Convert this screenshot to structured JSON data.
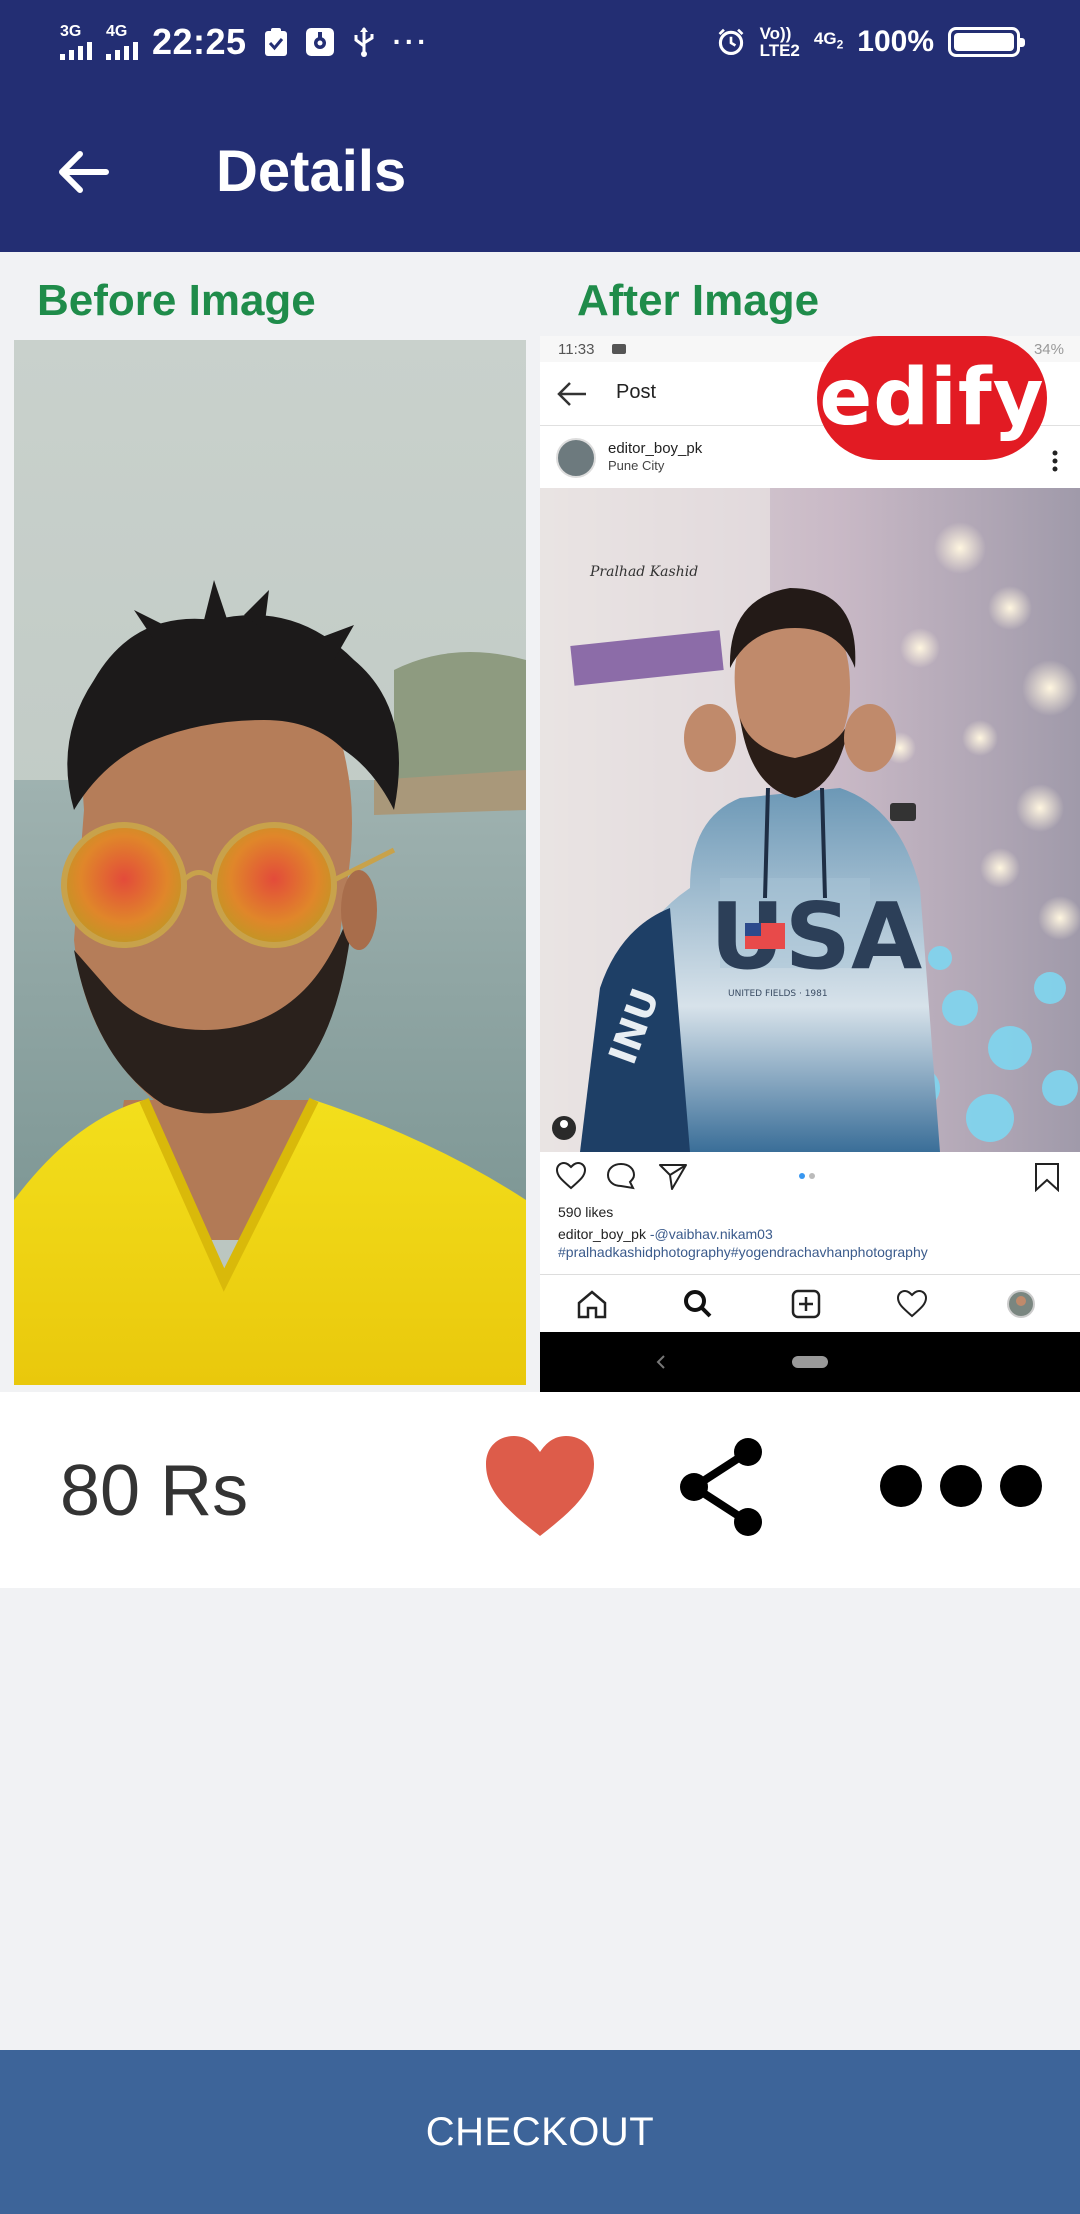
{
  "status_bar": {
    "network_1": "3G",
    "network_2": "4G",
    "time": "22:25",
    "volte_line1": "Vo))",
    "volte_line2": "LTE2",
    "network_3": "4G",
    "network_3_sub": "2",
    "battery": "100%",
    "dots": "···"
  },
  "app_bar": {
    "title": "Details"
  },
  "labels": {
    "before": "Before Image",
    "after": "After Image"
  },
  "after_image": {
    "status_time": "11:33",
    "status_battery": "34%",
    "header_title": "Post",
    "username": "editor_boy_pk",
    "location": "Pune City",
    "likes": "590 likes",
    "caption_user": "editor_boy_pk",
    "caption_mention": "-@vaibhav.nikam03",
    "hashtags": "#pralhadkashidphotography#yogendrachavhanphotography",
    "hoodie_text": "USA",
    "hoodie_sub": "UNITED FIELDS · 1981",
    "sleeve_text": "INU",
    "signature": "Pralhad Kashid"
  },
  "badge": {
    "text": "edify"
  },
  "info": {
    "price": "80 Rs"
  },
  "checkout": {
    "label": "CHECKOUT"
  },
  "colors": {
    "header": "#232e73",
    "label_green": "#1f8c4a",
    "heart": "#dd5c4a",
    "checkout": "#3d6499",
    "edify_red": "#e21b23"
  }
}
